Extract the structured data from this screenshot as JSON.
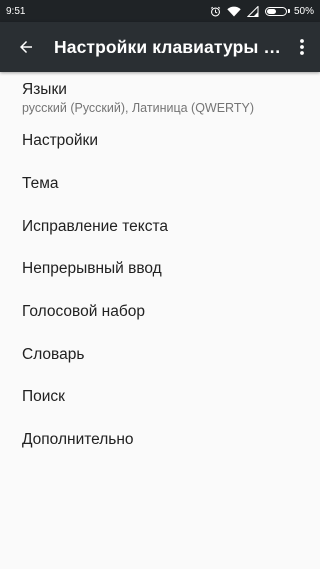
{
  "status_bar": {
    "time": "9:51",
    "battery_percent_label": "50%",
    "battery_level": 0.5,
    "icons": [
      "alarm-icon",
      "wifi-icon",
      "signal-icon",
      "battery-icon"
    ]
  },
  "toolbar": {
    "title": "Настройки клавиатуры G…",
    "back_icon": "arrow-back-icon",
    "menu_icon": "more-vert-icon"
  },
  "settings": {
    "languages": {
      "title": "Языки",
      "subtitle": "русский (Русский), Латиница (QWERTY)"
    },
    "items": [
      {
        "label": "Настройки"
      },
      {
        "label": "Тема"
      },
      {
        "label": "Исправление текста"
      },
      {
        "label": "Непрерывный ввод"
      },
      {
        "label": "Голосовой набор"
      },
      {
        "label": "Словарь"
      },
      {
        "label": "Поиск"
      },
      {
        "label": "Дополнительно"
      }
    ]
  },
  "colors": {
    "status_bar": "#1f2326",
    "toolbar": "#2a2f33",
    "background": "#fafafa",
    "primary_text": "#212121",
    "secondary_text": "#757575"
  }
}
